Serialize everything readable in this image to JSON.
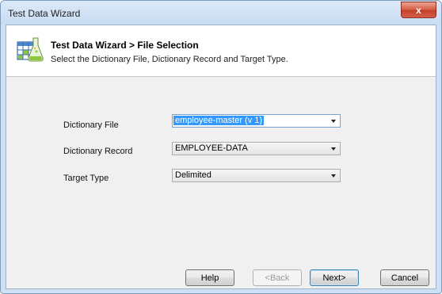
{
  "window": {
    "title": "Test Data Wizard",
    "close_glyph": "x"
  },
  "header": {
    "title": "Test Data Wizard > File Selection",
    "subtitle": "Select the Dictionary File, Dictionary Record and Target Type.",
    "icon": "table-flask-icon"
  },
  "form": {
    "dictionary_file": {
      "label": "Dictionary File",
      "value": "employee-master (v 1)"
    },
    "dictionary_record": {
      "label": "Dictionary Record",
      "value": "EMPLOYEE-DATA"
    },
    "target_type": {
      "label": "Target Type",
      "value": "Delimited"
    }
  },
  "buttons": {
    "help": "Help",
    "back": "<Back",
    "next": "Next>",
    "cancel": "Cancel"
  },
  "colors": {
    "selection": "#3399ff",
    "close": "#c4402a",
    "frame": "#cfe0f5"
  }
}
